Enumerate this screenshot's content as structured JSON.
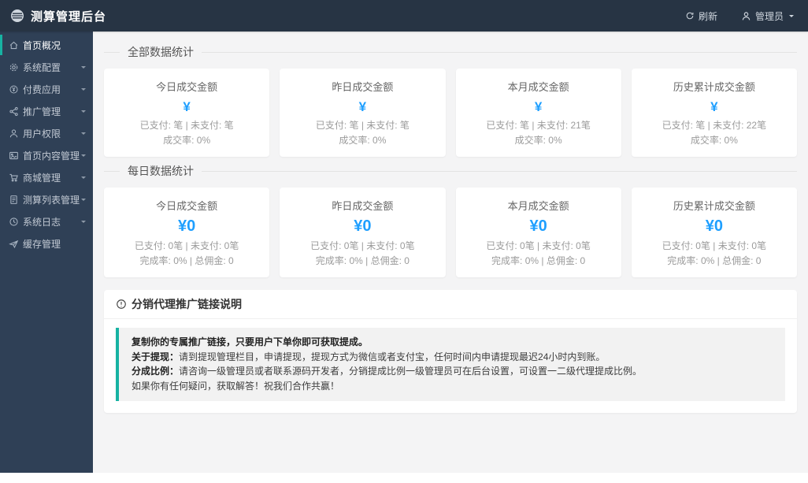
{
  "header": {
    "title": "测算管理后台",
    "refresh_label": "刷新",
    "user_label": "管理员",
    "logo_icon": "striped-circle-logo",
    "refresh_icon": "refresh-icon",
    "user_icon": "person-icon"
  },
  "sidebar": {
    "items": [
      {
        "label": "首页概况",
        "icon": "home-icon",
        "active": true,
        "has_submenu": false
      },
      {
        "label": "系统配置",
        "icon": "gear-icon",
        "active": false,
        "has_submenu": true
      },
      {
        "label": "付费应用",
        "icon": "yen-circle-icon",
        "active": false,
        "has_submenu": true
      },
      {
        "label": "推广管理",
        "icon": "share-icon",
        "active": false,
        "has_submenu": true
      },
      {
        "label": "用户权限",
        "icon": "user-icon",
        "active": false,
        "has_submenu": true
      },
      {
        "label": "首页内容管理",
        "icon": "image-icon",
        "active": false,
        "has_submenu": true
      },
      {
        "label": "商城管理",
        "icon": "cart-icon",
        "active": false,
        "has_submenu": true
      },
      {
        "label": "测算列表管理",
        "icon": "document-icon",
        "active": false,
        "has_submenu": true
      },
      {
        "label": "系统日志",
        "icon": "clock-icon",
        "active": false,
        "has_submenu": true
      },
      {
        "label": "缓存管理",
        "icon": "send-icon",
        "active": false,
        "has_submenu": false
      }
    ]
  },
  "sections": [
    {
      "title": "全部数据统计",
      "cards": [
        {
          "title": "今日成交金额",
          "amount": "¥",
          "line1": "已支付: 笔 | 未支付: 笔",
          "line2": "成交率: 0%"
        },
        {
          "title": "昨日成交金额",
          "amount": "¥",
          "line1": "已支付: 笔 | 未支付: 笔",
          "line2": "成交率: 0%"
        },
        {
          "title": "本月成交金额",
          "amount": "¥",
          "line1": "已支付: 笔 | 未支付: 21笔",
          "line2": "成交率: 0%"
        },
        {
          "title": "历史累计成交金额",
          "amount": "¥",
          "line1": "已支付: 笔 | 未支付: 22笔",
          "line2": "成交率: 0%"
        }
      ]
    },
    {
      "title": "每日数据统计",
      "cards": [
        {
          "title": "今日成交金额",
          "amount": "¥0",
          "line1": "已支付: 0笔 | 未支付: 0笔",
          "line2": "完成率: 0% | 总佣金: 0"
        },
        {
          "title": "昨日成交金额",
          "amount": "¥0",
          "line1": "已支付: 0笔 | 未支付: 0笔",
          "line2": "完成率: 0% | 总佣金: 0"
        },
        {
          "title": "本月成交金额",
          "amount": "¥0",
          "line1": "已支付: 0笔 | 未支付: 0笔",
          "line2": "完成率: 0% | 总佣金: 0"
        },
        {
          "title": "历史累计成交金额",
          "amount": "¥0",
          "line1": "已支付: 0笔 | 未支付: 0笔",
          "line2": "完成率: 0% | 总佣金: 0"
        }
      ]
    }
  ],
  "notice": {
    "icon": "info-circle-icon",
    "title": "分销代理推广链接说明",
    "lines": [
      {
        "bold": "复制你的专属推广链接，只要用户下单你即可获取提成。",
        "rest": ""
      },
      {
        "bold": "关于提现：",
        "rest": "请到提现管理栏目，申请提现，提现方式为微信或者支付宝，任何时间内申请提现最迟24小时内到账。"
      },
      {
        "bold": "分成比例：",
        "rest": "请咨询一级管理员或者联系源码开发者，分销提成比例一级管理员可在后台设置，可设置一二级代理提成比例。"
      },
      {
        "bold": "",
        "rest": "如果你有任何疑问，获取解答！祝我们合作共赢！"
      }
    ]
  },
  "colors": {
    "accent_blue": "#1E9FFF",
    "accent_green": "#17b3a3",
    "header_bg": "#273444",
    "sidebar_bg": "#2f4056",
    "content_bg": "#f4f4f5"
  }
}
